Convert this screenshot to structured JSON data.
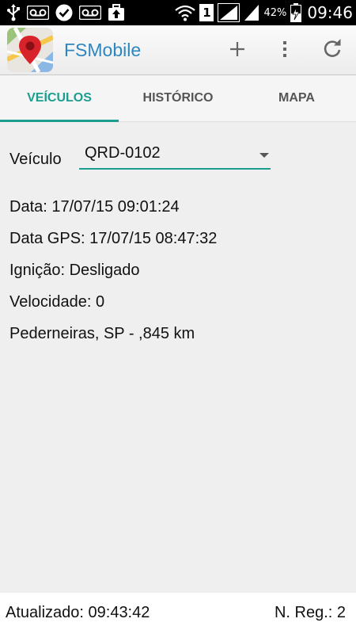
{
  "status_bar": {
    "icons_left": [
      "usb-icon",
      "voicemail-icon",
      "check-circle-icon",
      "voicemail-icon",
      "briefcase-upload-icon"
    ],
    "icons_right": [
      "wifi-icon",
      "sim-1-icon",
      "signal-icon",
      "signal-icon",
      "battery-charging-icon"
    ],
    "sim_slot": "1",
    "battery": "42%",
    "time": "09:46"
  },
  "app_bar": {
    "title": "FSMobile",
    "title_color": "#2e86c1",
    "actions": [
      "add-icon",
      "overflow-menu-icon",
      "refresh-icon"
    ]
  },
  "tabs": [
    {
      "label": "VEÍCULOS",
      "active": true
    },
    {
      "label": "HISTÓRICO",
      "active": false
    },
    {
      "label": "MAPA",
      "active": false
    }
  ],
  "accent_color": "#1b9e8e",
  "vehicle": {
    "label": "Veículo",
    "selected": "QRD-0102"
  },
  "details": {
    "data": "Data: 17/07/15 09:01:24",
    "data_gps": "Data GPS: 17/07/15 08:47:32",
    "ignicao": "Ignição: Desligado",
    "velocidade": "Velocidade: 0",
    "local": "Pederneiras, SP - ,845 km"
  },
  "footer": {
    "atualizado": "Atualizado: 09:43:42",
    "n_reg": "N. Reg.: 2"
  }
}
